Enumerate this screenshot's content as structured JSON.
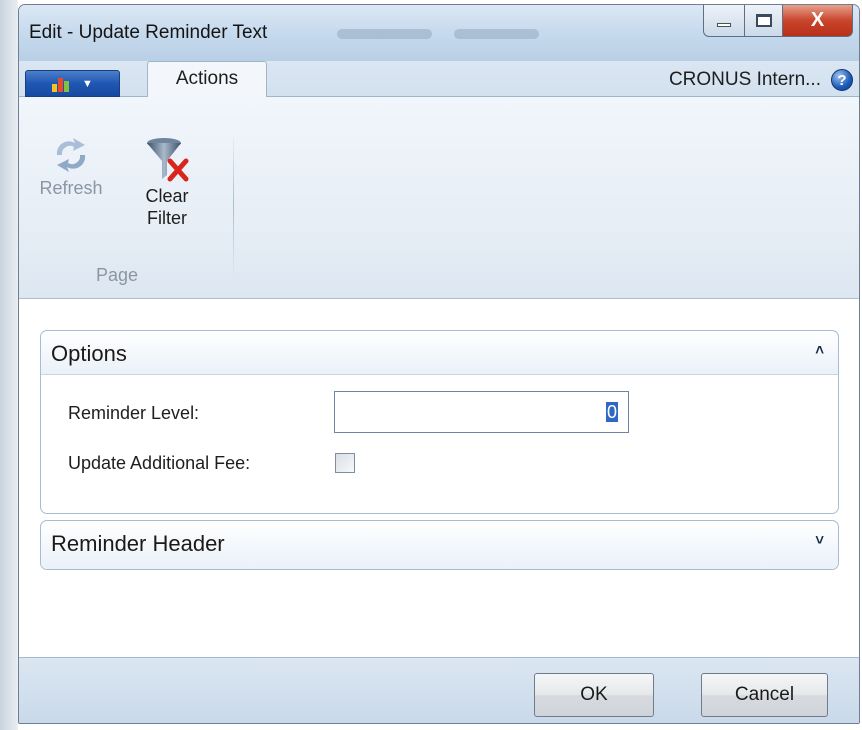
{
  "window": {
    "title": "Edit - Update Reminder Text",
    "close_glyph": "X",
    "help_glyph": "?"
  },
  "ribbon": {
    "tab_actions": "Actions",
    "company": "CRONUS Intern...",
    "refresh_label": "Refresh",
    "clear_filter_label_1": "Clear",
    "clear_filter_label_2": "Filter",
    "group_page": "Page"
  },
  "options": {
    "title": "Options",
    "reminder_level_label": "Reminder Level:",
    "reminder_level_value": "0",
    "update_fee_label": "Update Additional Fee:",
    "update_fee_checked": false
  },
  "reminder_header": {
    "title": "Reminder Header"
  },
  "buttons": {
    "ok": "OK",
    "cancel": "Cancel"
  },
  "colors": {
    "accent_blue": "#1f57b4",
    "close_red": "#c9452b",
    "selection_blue": "#2f68c3"
  },
  "icons": [
    "app-menu-icon",
    "help-icon",
    "refresh-icon",
    "clear-filter-icon",
    "chevron-up-icon",
    "chevron-down-icon"
  ]
}
